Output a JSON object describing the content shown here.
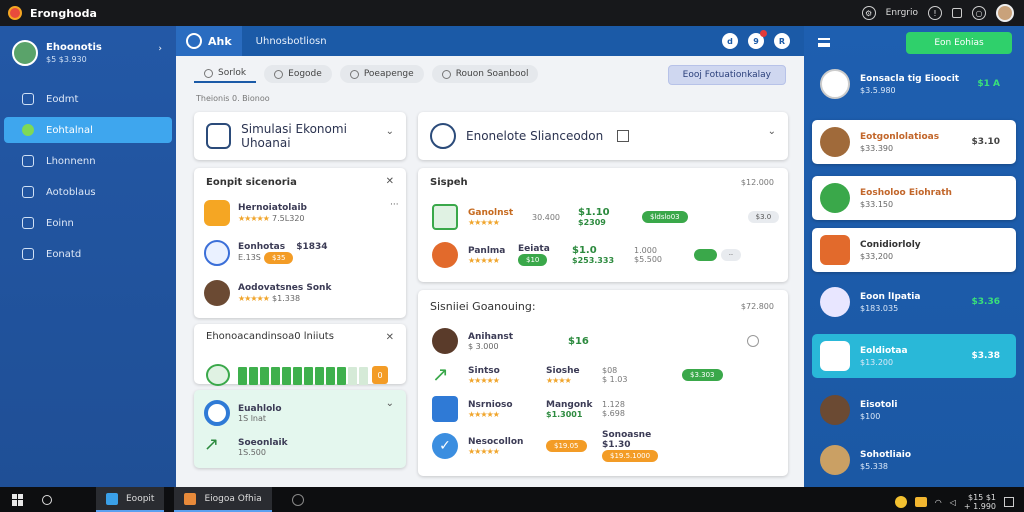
{
  "titlebar": {
    "title": "Eronghoda",
    "user_label": "Enrgrio",
    "bell": "9",
    "help": "!"
  },
  "sidebar": {
    "profile_name": "Ehoonotis",
    "profile_code": "$5 $3.930",
    "items": [
      {
        "label": "Eodmt",
        "icon": "home-icon"
      },
      {
        "label": "Eohtalnal",
        "icon": "leaf-icon",
        "active": true
      },
      {
        "label": "Lhonnenn",
        "icon": "grid-icon"
      },
      {
        "label": "Aotoblaus",
        "icon": "clock-icon"
      },
      {
        "label": "Eoinn",
        "icon": "people-icon"
      },
      {
        "label": "Eonatd",
        "icon": "chart-icon"
      }
    ]
  },
  "header": {
    "tab_label": "Ahk",
    "title": "Uhnosbotliosn",
    "icon_a": "d",
    "icon_b": "9",
    "icon_c": "R"
  },
  "toolbar": {
    "tabs": [
      "Sorlok",
      "Eogode",
      "Poeapenge",
      "Rouon Soanbool"
    ],
    "action": "Eooj Fotuationkalay",
    "breadcrumb": "Theionis 0. Bionoo"
  },
  "cards": {
    "hero_left": "Simulasi Ekonomi Uhoanai",
    "hero_right": "Enonelote Slianceodon",
    "list_title": "Eonpit sicenoria",
    "list_rows": [
      {
        "name": "Hernoiatolaib",
        "sub": "7.5L320",
        "stars": "★★★★★"
      },
      {
        "name": "Eonhotas",
        "sub": "E.13S",
        "value": "$1834",
        "pill": "$35"
      },
      {
        "name": "Aodovatsnes Sonk",
        "sub": "$1.338",
        "stars": "★★★★★"
      }
    ],
    "progress_title": "Ehonoacandinsoa0 lniiuts",
    "progress_value": "0",
    "progress_fraction": 0.85,
    "mint_row_1": {
      "name": "Euahlolo",
      "sub": "1S lnat"
    },
    "mint_row_2": {
      "name": "Soeonlaik",
      "sub": "1S.500"
    },
    "stock_title": "Sispeh",
    "stock_value": "$12.000",
    "stock_rows": [
      {
        "name": "Ganolnst",
        "sub": "30.400",
        "value": "$1.10",
        "value2": "$2309",
        "pill": "$ldslo03",
        "end": "$3.0"
      },
      {
        "name": "Panlma",
        "label": "Eeiata",
        "value": "$1.0",
        "value2": "$253.333",
        "mid": "1.000",
        "mid2": "$5.500",
        "pill": "$10"
      }
    ],
    "bottom_title": "Sisniiei Goanouing:",
    "bottom_value": "$72.800",
    "bottom_rows": [
      {
        "name": "Anihanst",
        "sub": "$ 3.000",
        "value": "$16"
      },
      {
        "name": "Sintso",
        "label": "Sioshe",
        "value": "$08",
        "value2": "$ 1.03",
        "pill": "$3.303"
      },
      {
        "name": "Nsrnioso",
        "label": "Mangonk",
        "value": "$1.3001",
        "mid": "1.128",
        "mid2": "$.698"
      },
      {
        "name": "Nesocollon",
        "sub": "$19.05",
        "value": "Sonoasne $1.30",
        "pill": "$19.5.1000"
      }
    ]
  },
  "rpanel": {
    "button": "Eon Eohias",
    "items": [
      {
        "name": "Eonsacla tig Eioocit",
        "sub": "$3.5.980",
        "value": "$1 A"
      },
      {
        "name": "Eotgonlolatioas",
        "sub": "$33.390",
        "value": "$3.10"
      },
      {
        "name": "Eosholoo Eiohrath",
        "sub": "$33.150",
        "value": ""
      },
      {
        "name": "Conidiorloly",
        "sub": "$33,200",
        "value": ""
      },
      {
        "name": "Eoon lIpatia",
        "sub": "$183.035",
        "value": "$3.36"
      },
      {
        "name": "Eoldiotaa",
        "sub": "$13.200",
        "value": "$3.38"
      },
      {
        "name": "Eisotoli",
        "sub": "$100",
        "value": ""
      },
      {
        "name": "Sohotliaio",
        "sub": "$5.338",
        "value": ""
      }
    ]
  },
  "taskbar": {
    "task1": "Eoopit",
    "task2": "Eiogoa Ofhia",
    "time": "$15 $1",
    "date": "+ 1.990"
  }
}
